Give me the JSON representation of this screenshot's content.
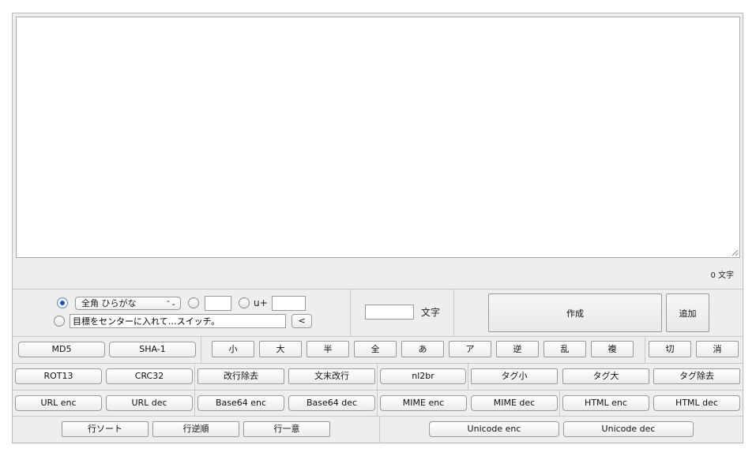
{
  "textarea": {
    "value": ""
  },
  "char_count": "0 文字",
  "options": {
    "selected_mode": "全角 ひらがな",
    "select_arrows": "⌃⌄",
    "code_value": "",
    "unicode_prefix": "u+",
    "unicode_value": "",
    "text_value": "目標をセンターに入れて…スイッチ。",
    "arrow_button": "<"
  },
  "generator": {
    "length_value": "",
    "length_unit": "文字",
    "create_button": "作成",
    "add_button": "追加"
  },
  "rows": {
    "row1": {
      "md5": "MD5",
      "sha1": "SHA-1",
      "small": "小",
      "large": "大",
      "half": "半",
      "full": "全",
      "hiragana": "あ",
      "katakana": "ア",
      "reverse": "逆",
      "random": "乱",
      "duplicate": "複",
      "cut": "切",
      "erase": "消"
    },
    "row2": {
      "rot13": "ROT13",
      "crc32": "CRC32",
      "remove_newlines": "改行除去",
      "sentence_newline": "文末改行",
      "nl2br": "nl2br",
      "tag_lower": "タグ小",
      "tag_upper": "タグ大",
      "tag_remove": "タグ除去"
    },
    "row3": {
      "url_enc": "URL enc",
      "url_dec": "URL dec",
      "base64_enc": "Base64 enc",
      "base64_dec": "Base64 dec",
      "mime_enc": "MIME enc",
      "mime_dec": "MIME dec",
      "html_enc": "HTML enc",
      "html_dec": "HTML dec"
    },
    "row4": {
      "line_sort": "行ソート",
      "line_reverse": "行逆順",
      "line_unique": "行一意",
      "unicode_enc": "Unicode enc",
      "unicode_dec": "Unicode dec"
    }
  }
}
